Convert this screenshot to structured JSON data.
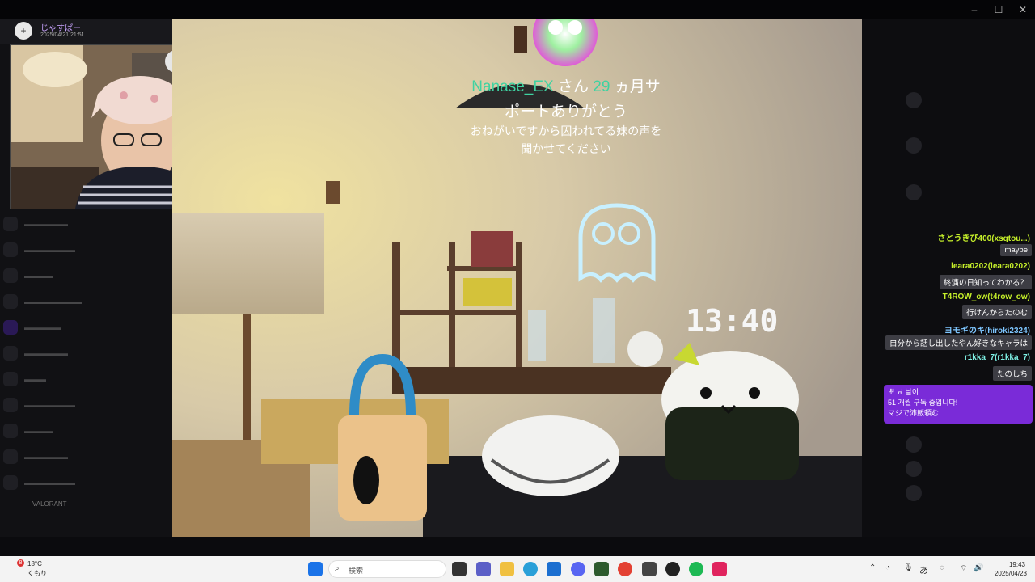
{
  "sender": {
    "name": "じゃすぱー",
    "time": "2025/04/21 21:51",
    "avatar": "+"
  },
  "stream": {
    "alert": {
      "user": "Nanase_EX",
      "san": "さん",
      "months": "29",
      "tail1": "ヵ月サ",
      "line2": "ポートありがとう",
      "message1": "おねがいですから囚われてる妹の声を",
      "message2": "聞かせてください"
    },
    "clock": "13:40"
  },
  "chat": {
    "messages": [
      {
        "user": "さとうきび400(xsqtou...)",
        "text": "maybe",
        "style": ""
      },
      {
        "user": "leara0202(leara0202)",
        "text": "終演の日知ってわかる？",
        "style": ""
      },
      {
        "user": "T4ROW_ow(t4row_ow)",
        "text": "行けんからたのむ",
        "style": ""
      },
      {
        "user": "ヨモギのキ(hiroki2324)",
        "text": "自分から話し出したやん好きなキャラは",
        "style": "c2"
      },
      {
        "user": "r1kka_7(r1kka_7)",
        "text": "たのしち",
        "style": "c3"
      }
    ],
    "sub": {
      "line1": "뽀 뵤 날이",
      "line2": "51 개월 구독 중입니다!",
      "line3": "マジで沛飯頼む"
    }
  },
  "sidebar": {
    "valorant": "VALORANT"
  },
  "taskbar": {
    "search_placeholder": "検索",
    "weather_temp": "18°C",
    "weather_cond": "くもり",
    "weather_badge": "8",
    "ime": "あ",
    "time": "19:43",
    "date": "2025/04/23"
  },
  "icons": {
    "zoom": "magnifier-icon",
    "share": "share-icon",
    "download": "download-icon",
    "external": "external-icon",
    "more": "more-icon",
    "close": "close-icon"
  }
}
